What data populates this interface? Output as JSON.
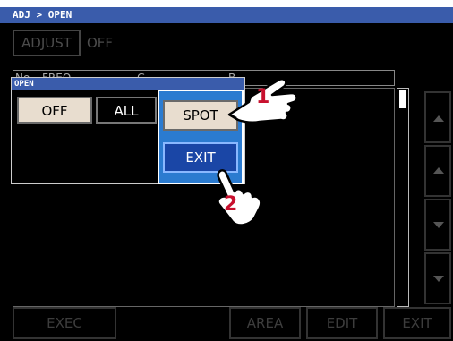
{
  "window": {
    "title": "ADJ > OPEN"
  },
  "adjust": {
    "label": "ADJUST",
    "value": "OFF"
  },
  "list": {
    "headers": [
      "No",
      "FREQ",
      "G",
      "B"
    ]
  },
  "dialog": {
    "title": "OPEN",
    "buttons": {
      "off": "OFF",
      "all": "ALL"
    }
  },
  "popup": {
    "spot": "SPOT",
    "exit": "EXIT"
  },
  "callouts": [
    "1",
    "2"
  ],
  "bottom_bar": {
    "exec": "EXEC",
    "area": "AREA",
    "edit": "EDIT",
    "exit": "EXIT"
  },
  "colors": {
    "titlebar": "#3a5cab",
    "highlight": "#2b7bd0",
    "spot_bg": "#e8ddcf",
    "exit_bg": "#1a46a6",
    "callout": "#c8102e"
  }
}
